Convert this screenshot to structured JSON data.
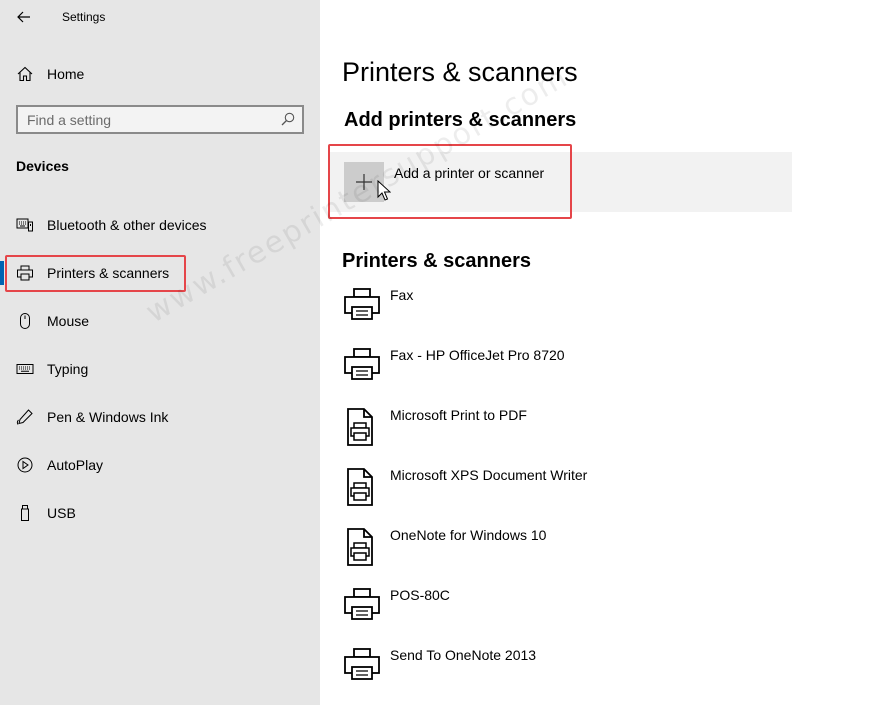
{
  "window": {
    "title": "Settings"
  },
  "sidebar": {
    "home_label": "Home",
    "search_placeholder": "Find a setting",
    "section_title": "Devices",
    "items": [
      {
        "label": "Bluetooth & other devices",
        "icon": "bluetooth-devices-icon"
      },
      {
        "label": "Printers & scanners",
        "icon": "printer-icon",
        "selected": true
      },
      {
        "label": "Mouse",
        "icon": "mouse-icon"
      },
      {
        "label": "Typing",
        "icon": "keyboard-icon"
      },
      {
        "label": "Pen & Windows Ink",
        "icon": "pen-icon"
      },
      {
        "label": "AutoPlay",
        "icon": "autoplay-icon"
      },
      {
        "label": "USB",
        "icon": "usb-icon"
      }
    ]
  },
  "main": {
    "title": "Printers & scanners",
    "add_section_title": "Add printers & scanners",
    "add_button_label": "Add a printer or scanner",
    "list_section_title": "Printers & scanners",
    "printers": [
      {
        "name": "Fax",
        "icon": "printer-icon"
      },
      {
        "name": "Fax - HP OfficeJet Pro 8720",
        "icon": "printer-icon"
      },
      {
        "name": "Microsoft Print to PDF",
        "icon": "document-printer-icon"
      },
      {
        "name": "Microsoft XPS Document Writer",
        "icon": "document-printer-icon"
      },
      {
        "name": "OneNote for Windows 10",
        "icon": "document-printer-icon"
      },
      {
        "name": "POS-80C",
        "icon": "printer-icon"
      },
      {
        "name": "Send To OneNote 2013",
        "icon": "printer-icon"
      }
    ]
  },
  "watermark": "www.freeprintersupport.com",
  "colors": {
    "accent": "#0063b1",
    "highlight": "#e54549",
    "sidebar_bg": "#e6e6e6"
  }
}
